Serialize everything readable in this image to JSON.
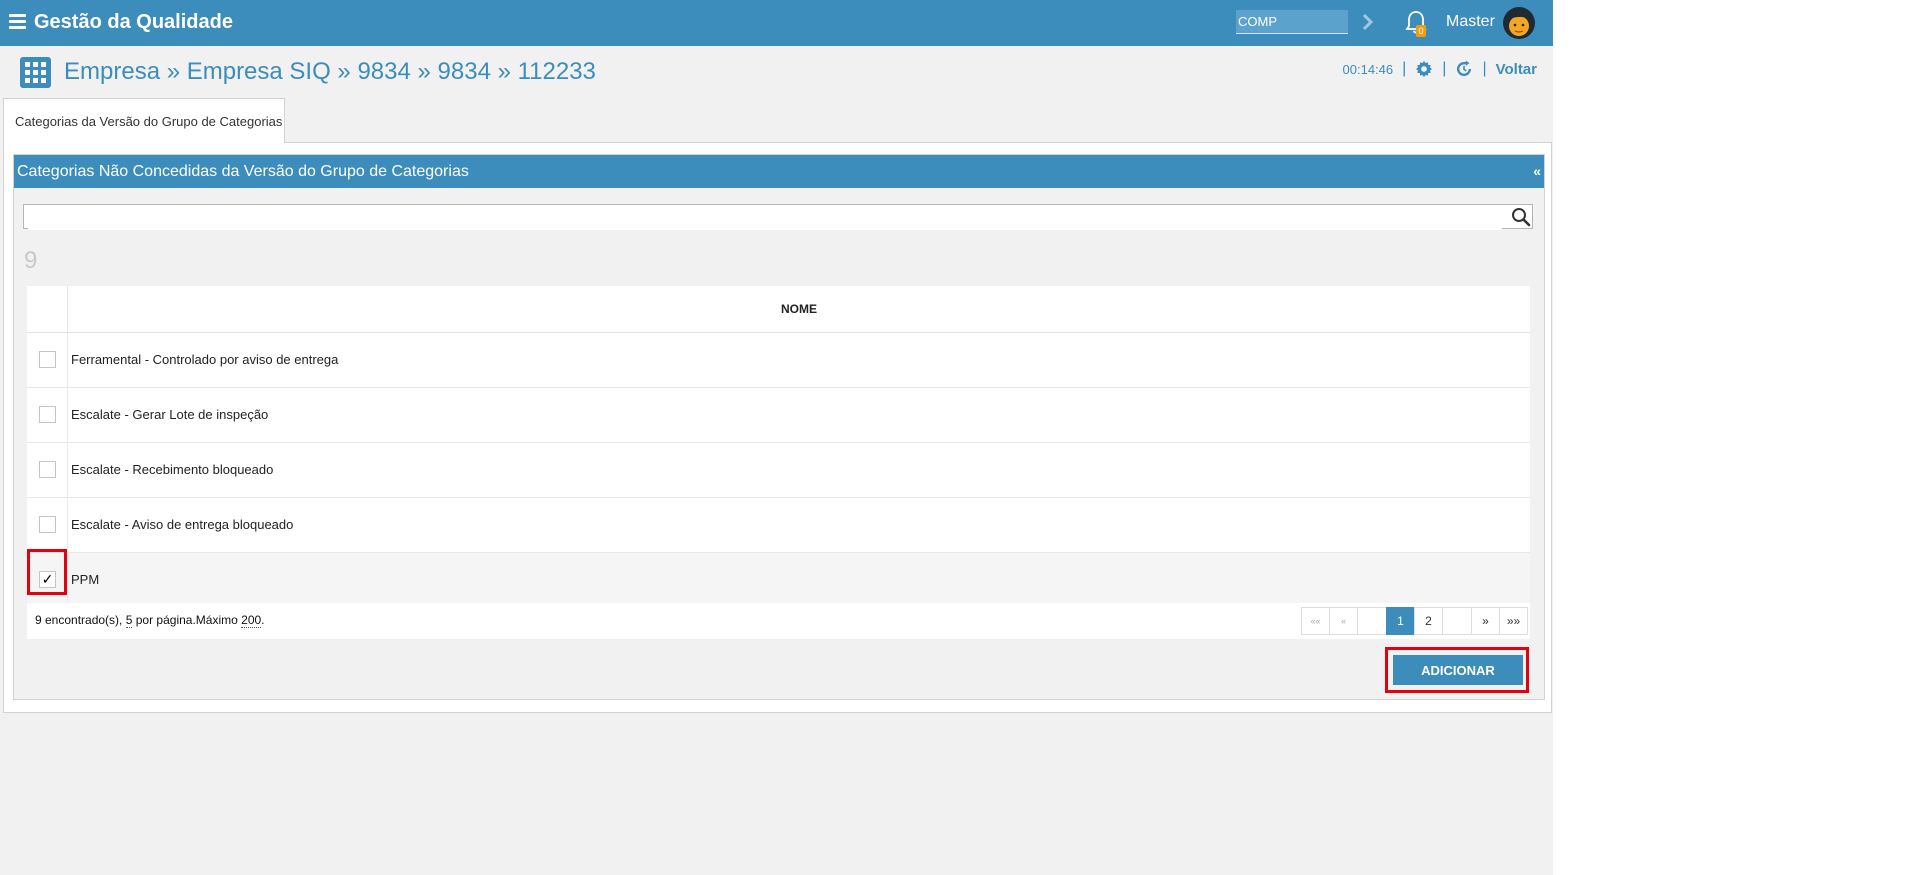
{
  "app": {
    "title": "Gestão da Qualidade"
  },
  "topbar": {
    "company_value": "COMP",
    "notification_count": "0",
    "user_name": "Master"
  },
  "header": {
    "breadcrumb": "Empresa » Empresa SIQ » 9834 » 9834 » 112233",
    "clock": "00:14:46",
    "separator": "|",
    "back_label": "Voltar"
  },
  "tabs": [
    {
      "label": "Categorias da Versão do Grupo de Categorias",
      "active": true
    }
  ],
  "panel": {
    "title": "Categorias Não Concedidas da Versão do Grupo de Categorias",
    "collapse_label": "«",
    "search_placeholder": "",
    "count": "9",
    "column_header": "NOME",
    "rows": [
      {
        "name": "Ferramental - Controlado por aviso de entrega",
        "checked": false
      },
      {
        "name": "Escalate - Gerar Lote de inspeção",
        "checked": false
      },
      {
        "name": "Escalate - Recebimento bloqueado",
        "checked": false
      },
      {
        "name": "Escalate - Aviso de entrega bloqueado",
        "checked": false
      },
      {
        "name": "PPM",
        "checked": true
      }
    ],
    "check_mark": "✓",
    "footer": {
      "found_text": "9 encontrado(s), ",
      "per_page": "5",
      "per_page_text": " por página.Máximo ",
      "max": "200",
      "end": "."
    },
    "pagination": {
      "first": "««",
      "prev": "«",
      "pages": [
        "1",
        "2"
      ],
      "current": "1",
      "next": "»",
      "last": "»»"
    },
    "add_button": "ADICIONAR"
  },
  "colors": {
    "primary": "#3c8dbc",
    "highlight": "#e3000f",
    "badge": "#f39c12"
  }
}
